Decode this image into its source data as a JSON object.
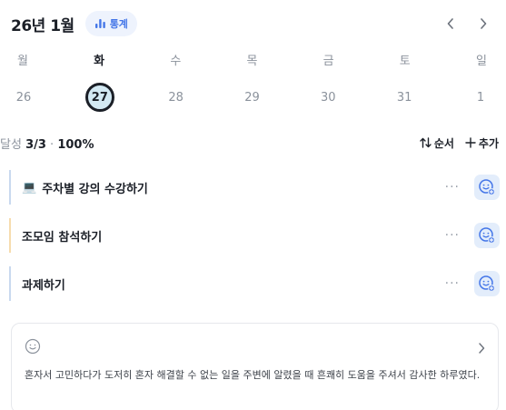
{
  "header": {
    "month_title": "26년 1월",
    "stats_label": "통계",
    "accent": "#4476e8"
  },
  "week": {
    "days": [
      {
        "dow": "월",
        "date": "26"
      },
      {
        "dow": "화",
        "date": "27",
        "selected": true
      },
      {
        "dow": "수",
        "date": "28"
      },
      {
        "dow": "목",
        "date": "29"
      },
      {
        "dow": "금",
        "date": "30"
      },
      {
        "dow": "토",
        "date": "31"
      },
      {
        "dow": "일",
        "date": "1"
      }
    ]
  },
  "summary": {
    "prefix": "달성",
    "count": "3/3",
    "separator": "·",
    "percent": "100%",
    "order_label": "순서",
    "add_label": "추가"
  },
  "tasks": [
    {
      "icon": "laptop-icon",
      "emoji": "💻",
      "title": "주차별 강의 수강하기",
      "accent": "#c9d9ef"
    },
    {
      "title": "조모임 참석하기",
      "accent": "#f6dcae"
    },
    {
      "title": "과제하기",
      "accent": "#c9d9ef"
    }
  ],
  "memo": {
    "text": "혼자서 고민하다가 도저히 혼자 해결할 수 없는 일을 주변에 알렸을 때 흔쾌히 도움을 주셔서 감사한 하루였다."
  }
}
